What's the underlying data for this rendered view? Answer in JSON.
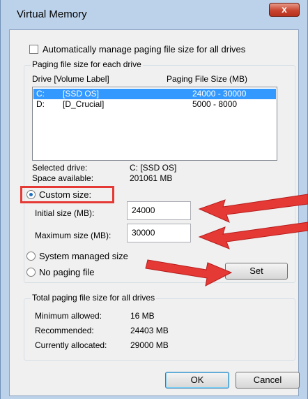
{
  "window": {
    "title": "Virtual Memory",
    "close_glyph": "x"
  },
  "auto_manage": {
    "label": "Automatically manage paging file size for all drives",
    "checked": false
  },
  "paging_group": {
    "title": "Paging file size for each drive",
    "header_drive": "Drive  [Volume Label]",
    "header_size": "Paging File Size (MB)",
    "drives": [
      {
        "letter": "C:",
        "label": "[SSD OS]",
        "size": "24000 - 30000",
        "selected": true
      },
      {
        "letter": "D:",
        "label": "[D_Crucial]",
        "size": "5000 - 8000",
        "selected": false
      }
    ],
    "selected_drive_label": "Selected drive:",
    "selected_drive_value": "C:  [SSD OS]",
    "space_label": "Space available:",
    "space_value": "201061 MB",
    "custom_label": "Custom size:",
    "initial_label": "Initial size (MB):",
    "initial_value": "24000",
    "max_label": "Maximum size (MB):",
    "max_value": "30000",
    "system_label": "System managed size",
    "nopaging_label": "No paging file",
    "set_label": "Set"
  },
  "totals_group": {
    "title": "Total paging file size for all drives",
    "min_label": "Minimum allowed:",
    "min_value": "16 MB",
    "rec_label": "Recommended:",
    "rec_value": "24403 MB",
    "cur_label": "Currently allocated:",
    "cur_value": "29000 MB"
  },
  "buttons": {
    "ok": "OK",
    "cancel": "Cancel"
  },
  "colors": {
    "annotation": "#e53935",
    "selection": "#3399ff",
    "accent_radio": "#1f6fc0"
  }
}
